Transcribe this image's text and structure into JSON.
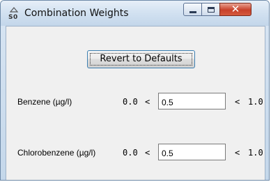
{
  "window": {
    "title": "Combination Weights",
    "icons": {
      "app": "weights-icon",
      "minimize": "minimize-icon",
      "maximize": "maximize-icon",
      "close": "close-icon"
    }
  },
  "revert_button_label": "Revert to Defaults",
  "rows": [
    {
      "label": "Benzene (µg/l)",
      "min": "0.0",
      "lt": "<",
      "value": "0.5",
      "lt2": "<",
      "max": "1.0"
    },
    {
      "label": "Chlorobenzene (µg/l)",
      "min": "0.0",
      "lt": "<",
      "value": "0.5",
      "lt2": "<",
      "max": "1.0"
    }
  ]
}
